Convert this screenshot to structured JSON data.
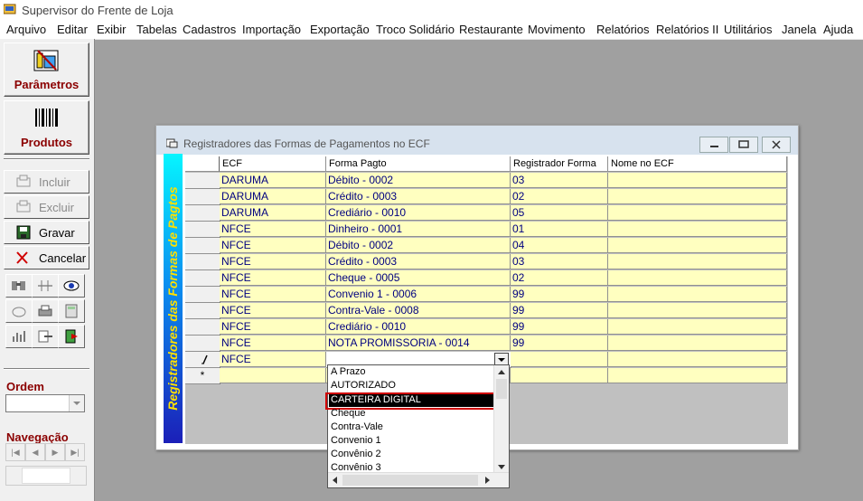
{
  "app": {
    "title": "Supervisor do Frente de Loja"
  },
  "menu": [
    "Arquivo",
    "Editar",
    "Exibir",
    "Tabelas",
    "Cadastros",
    "Importação",
    "Exportação",
    "Troco Solidário",
    "Restaurante",
    "Movimento",
    "Relatórios",
    "Relatórios II",
    "Utilitários",
    "Janela",
    "Ajuda"
  ],
  "sidebar": {
    "parametros_label": "Parâmetros",
    "produtos_label": "Produtos",
    "actions": [
      {
        "label": "Incluir",
        "enabled": false,
        "icon": "add-record-icon"
      },
      {
        "label": "Excluir",
        "enabled": false,
        "icon": "delete-record-icon"
      },
      {
        "label": "Gravar",
        "enabled": true,
        "icon": "save-disk-icon"
      },
      {
        "label": "Cancelar",
        "enabled": true,
        "icon": "cancel-x-icon"
      }
    ],
    "ordem_label": "Ordem",
    "navegacao_label": "Navegação"
  },
  "child_window": {
    "title": "Registradores das Formas de Pagamentos no ECF",
    "banner": "Registradores das Formas de Pagtos",
    "columns": [
      "ECF",
      "Forma Pagto",
      "Registrador Forma",
      "Nome no ECF"
    ],
    "rows": [
      [
        "DARUMA",
        "Débito  -  0002",
        "03",
        ""
      ],
      [
        "DARUMA",
        "Crédito  -  0003",
        "02",
        ""
      ],
      [
        "DARUMA",
        "Crediário  -  0010",
        "05",
        ""
      ],
      [
        "NFCE",
        "Dinheiro  -  0001",
        "01",
        ""
      ],
      [
        "NFCE",
        "Débito  -  0002",
        "04",
        ""
      ],
      [
        "NFCE",
        "Crédito  -  0003",
        "03",
        ""
      ],
      [
        "NFCE",
        "Cheque  -  0005",
        "02",
        ""
      ],
      [
        "NFCE",
        "Convenio 1  -  0006",
        "99",
        ""
      ],
      [
        "NFCE",
        "Contra-Vale  -  0008",
        "99",
        ""
      ],
      [
        "NFCE",
        "Crediário  -  0010",
        "99",
        ""
      ],
      [
        "NFCE",
        "NOTA PROMISSORIA  -  0014",
        "99",
        ""
      ]
    ],
    "edit_row": {
      "ecf": "NFCE",
      "indicator": "pencil-icon"
    },
    "new_row": {
      "indicator": "*"
    },
    "dropdown_options": [
      "A Prazo",
      "AUTORIZADO",
      "CARTEIRA DIGITAL",
      "Cheque",
      "Contra-Vale",
      "Convenio 1",
      "Convênio 2",
      "Convênio 3"
    ],
    "dropdown_selected": "CARTEIRA DIGITAL"
  }
}
